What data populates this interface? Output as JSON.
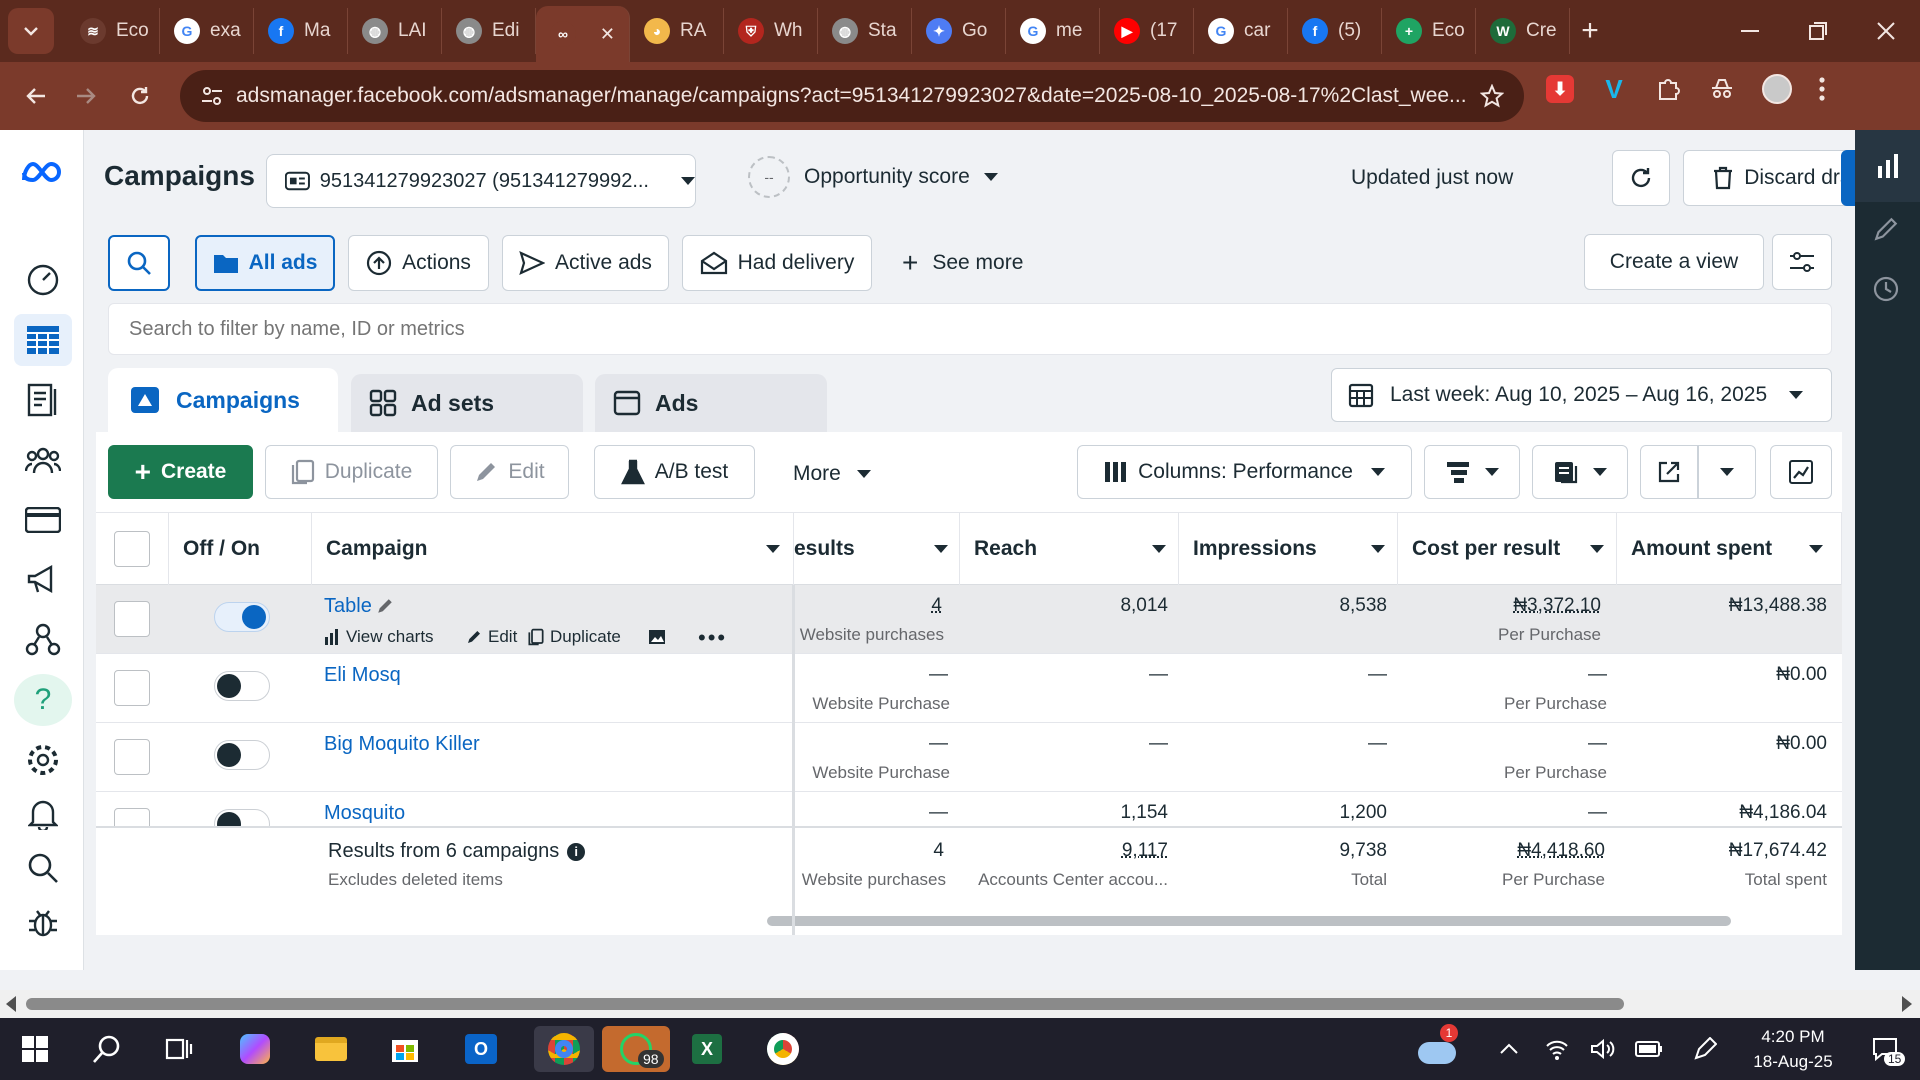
{
  "browser": {
    "tabs": [
      {
        "label": "Eco",
        "fav_color": "#6b3a2e",
        "fav_text": "≋"
      },
      {
        "label": "exa",
        "fav_color": "#ffffff",
        "fav_text": "G"
      },
      {
        "label": "Ma",
        "fav_color": "#1877f2",
        "fav_text": "f"
      },
      {
        "label": "LAI",
        "fav_color": "#8a8a8a",
        "fav_text": "◍"
      },
      {
        "label": "Edi",
        "fav_color": "#8a8a8a",
        "fav_text": "◍"
      },
      {
        "label": "",
        "fav_color": "#7b3a2b",
        "fav_text": "∞"
      },
      {
        "label": "RA",
        "fav_color": "#f2b84b",
        "fav_text": "◕"
      },
      {
        "label": "Wh",
        "fav_color": "#b3261e",
        "fav_text": "⛨"
      },
      {
        "label": "Sta",
        "fav_color": "#8a8a8a",
        "fav_text": "◍"
      },
      {
        "label": "Go",
        "fav_color": "#4e7cf4",
        "fav_text": "✦"
      },
      {
        "label": "me",
        "fav_color": "#ffffff",
        "fav_text": "G"
      },
      {
        "label": "(17",
        "fav_color": "#ff0000",
        "fav_text": "▶"
      },
      {
        "label": "car",
        "fav_color": "#ffffff",
        "fav_text": "G"
      },
      {
        "label": "(5)",
        "fav_color": "#1877f2",
        "fav_text": "f"
      },
      {
        "label": "Eco",
        "fav_color": "#1fa463",
        "fav_text": "+"
      },
      {
        "label": "Cre",
        "fav_color": "#1e6b3a",
        "fav_text": "W"
      }
    ],
    "url": "adsmanager.facebook.com/adsmanager/manage/campaigns?act=951341279923027&date=2025-08-10_2025-08-17%2Clast_wee..."
  },
  "header": {
    "title": "Campaigns",
    "account": "951341279923027 (951341279992...",
    "opportunity_label": "Opportunity score",
    "opportunity_value": "--",
    "updated": "Updated just now",
    "discard": "Discard drafts"
  },
  "filters": {
    "all_ads": "All ads",
    "actions": "Actions",
    "active_ads": "Active ads",
    "had_delivery": "Had delivery",
    "see_more": "See more",
    "create_view": "Create a view",
    "search_placeholder": "Search to filter by name, ID or metrics"
  },
  "tabs": {
    "campaigns": "Campaigns",
    "ad_sets": "Ad sets",
    "ads": "Ads",
    "date_range": "Last week: Aug 10, 2025 – Aug 16, 2025"
  },
  "toolbar": {
    "create": "Create",
    "duplicate": "Duplicate",
    "edit": "Edit",
    "ab_test": "A/B test",
    "more": "More",
    "columns": "Columns: Performance"
  },
  "table": {
    "headers": {
      "off_on": "Off / On",
      "campaign": "Campaign",
      "results": "esults",
      "reach": "Reach",
      "impressions": "Impressions",
      "cost_per_result": "Cost per result",
      "amount_spent": "Amount spent"
    },
    "row_actions": {
      "view_charts": "View charts",
      "edit": "Edit",
      "duplicate": "Duplicate"
    },
    "rows": [
      {
        "name": "Table",
        "on": true,
        "results": "4",
        "results_sub": "Website purchases",
        "reach": "8,014",
        "impressions": "8,538",
        "cpr": "₦3,372.10",
        "cpr_sub": "Per Purchase",
        "spent": "₦13,488.38"
      },
      {
        "name": "Eli Mosq",
        "on": false,
        "results": "—",
        "results_sub": "Website Purchase",
        "reach": "—",
        "impressions": "—",
        "cpr": "—",
        "cpr_sub": "Per Purchase",
        "spent": "₦0.00"
      },
      {
        "name": "Big Moquito Killer",
        "on": false,
        "results": "—",
        "results_sub": "Website Purchase",
        "reach": "—",
        "impressions": "—",
        "cpr": "—",
        "cpr_sub": "Per Purchase",
        "spent": "₦0.00"
      },
      {
        "name": "Mosquito",
        "on": false,
        "results": "—",
        "results_sub": "",
        "reach": "1,154",
        "impressions": "1,200",
        "cpr": "—",
        "cpr_sub": "",
        "spent": "₦4,186.04"
      }
    ],
    "footer": {
      "label": "Results from 6 campaigns",
      "note": "Excludes deleted items",
      "results": "4",
      "results_sub": "Website purchases",
      "reach": "9,117",
      "reach_sub": "Accounts Center accou...",
      "impressions": "9,738",
      "impressions_sub": "Total",
      "cpr": "₦4,418.60",
      "cpr_sub": "Per Purchase",
      "spent": "₦17,674.42",
      "spent_sub": "Total spent"
    }
  },
  "taskbar": {
    "time": "4:20 PM",
    "date": "18-Aug-25",
    "whatsapp_badge": "98",
    "weather_badge": "1",
    "notif_count": "15"
  }
}
